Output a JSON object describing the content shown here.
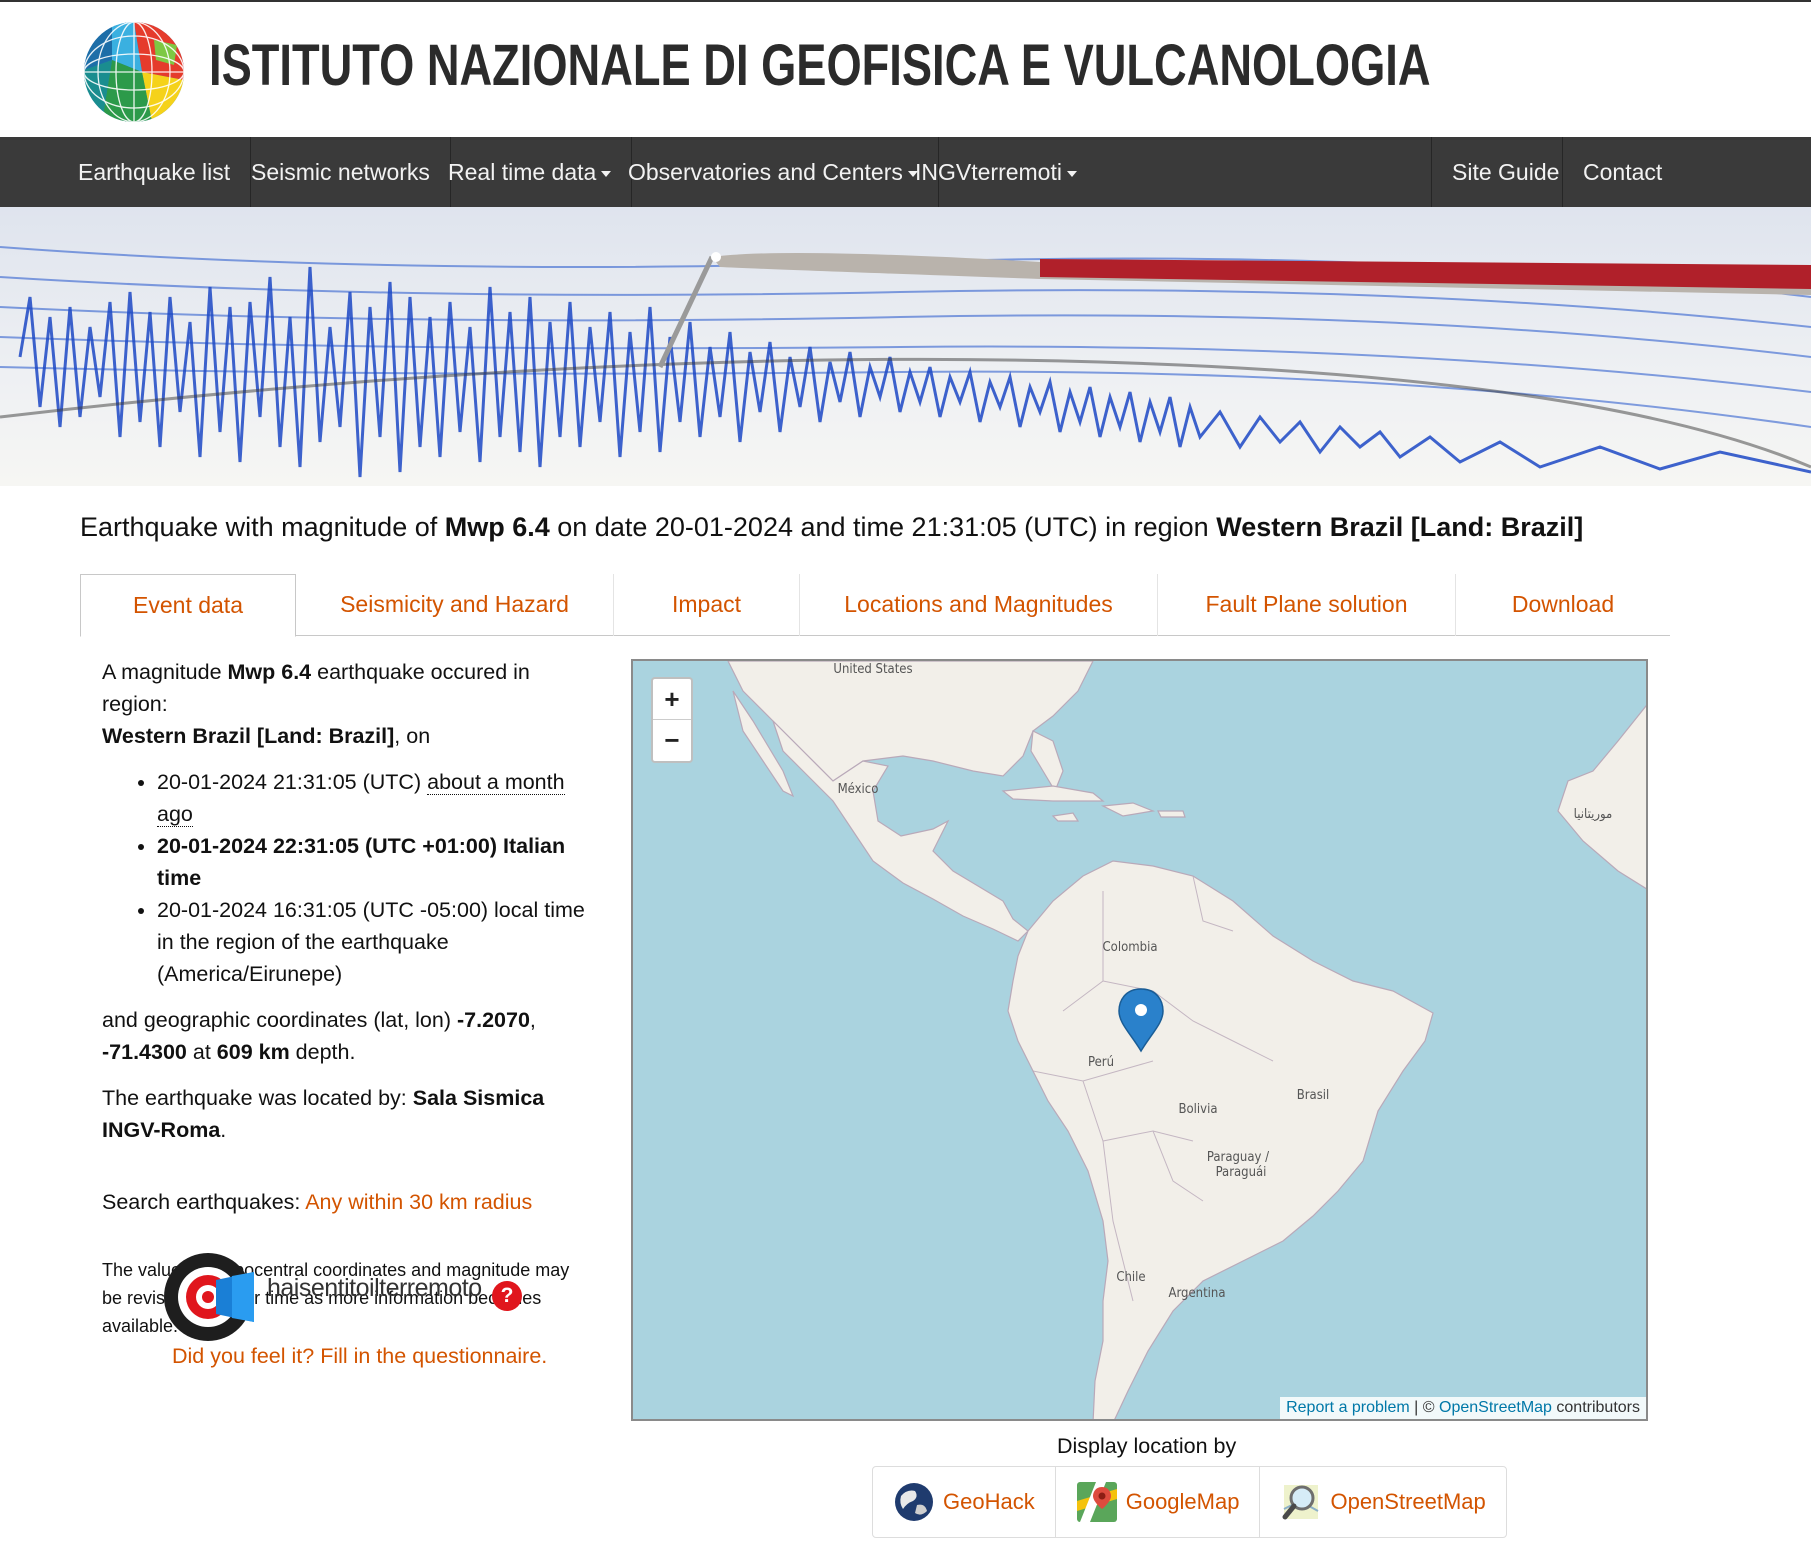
{
  "header": {
    "title": "ISTITUTO NAZIONALE DI GEOFISICA E VULCANOLOGIA"
  },
  "nav": {
    "items": [
      {
        "label": "Earthquake list",
        "dropdown": false
      },
      {
        "label": "Seismic networks",
        "dropdown": false
      },
      {
        "label": "Real time data",
        "dropdown": true
      },
      {
        "label": "Observatories and Centers",
        "dropdown": true
      },
      {
        "label": "INGVterremoti",
        "dropdown": true
      }
    ],
    "right_items": [
      {
        "label": "Site Guide"
      },
      {
        "label": "Contact"
      }
    ]
  },
  "headline": {
    "prefix": "Earthquake with magnitude of ",
    "magnitude": "Mwp 6.4",
    "mid1": " on date ",
    "date": "20-01-2024",
    "mid2": " and time ",
    "time": "21:31:05 (UTC)",
    "mid3": " in region ",
    "region": "Western Brazil [Land: Brazil]"
  },
  "tabs": [
    {
      "label": "Event data",
      "active": true
    },
    {
      "label": "Seismicity and Hazard",
      "active": false
    },
    {
      "label": "Impact",
      "active": false
    },
    {
      "label": "Locations and Magnitudes",
      "active": false
    },
    {
      "label": "Fault Plane solution",
      "active": false
    },
    {
      "label": "Download",
      "active": false
    }
  ],
  "event": {
    "intro_a": "A magnitude ",
    "magnitude": "Mwp 6.4",
    "intro_b": " earthquake occured in region:",
    "region": "Western Brazil [Land: Brazil]",
    "intro_c": ", on",
    "times": {
      "utc": "20-01-2024 21:31:05 (UTC)",
      "ago": "about a month ago",
      "italian": "20-01-2024 22:31:05 (UTC +01:00) Italian time",
      "local": "20-01-2024 16:31:05 (UTC -05:00) local time in the region of the earthquake (America/Eirunepe)"
    },
    "coords_a": "and geographic coordinates (lat, lon) ",
    "lat": "-7.2070",
    "comma": ",",
    "lon": "-71.4300",
    "at": " at ",
    "depth": "609 km",
    "depth_suffix": " depth.",
    "located_a": "The earthquake was located by: ",
    "located_by": "Sala Sismica INGV-Roma",
    "located_end": ".",
    "search_label": "Search earthquakes: ",
    "search_link": "Any within 30 km radius",
    "note": "The values of hypocentral coordinates and magnitude may be revised at a later time as more information becomes available.",
    "hsit_logo_text": "haisentitoilterremoto",
    "hsit_q": "?",
    "feel_link": "Did you feel it? Fill in the questionnaire."
  },
  "map": {
    "zoom_in": "+",
    "zoom_out": "−",
    "labels": {
      "us": "United States",
      "mexico": "México",
      "colombia": "Colombia",
      "peru": "Perú",
      "bolivia": "Bolivia",
      "brasil": "Brasil",
      "paraguay": "Paraguay /",
      "paraguai": "Paraguái",
      "chile": "Chile",
      "argentina": "Argentina",
      "mauritania": "موريتانيا"
    },
    "attribution": {
      "report": "Report a problem",
      "sep": " | © ",
      "osm": "OpenStreetMap",
      "contrib": " contributors"
    }
  },
  "display": {
    "title": "Display location by",
    "buttons": [
      {
        "label": "GeoHack",
        "icon": "globe-icon"
      },
      {
        "label": "GoogleMap",
        "icon": "googlemap-icon"
      },
      {
        "label": "OpenStreetMap",
        "icon": "magnifier-icon"
      }
    ]
  },
  "colors": {
    "link": "#d35400",
    "navbar": "#3a3a3a",
    "map_water": "#aad3df",
    "map_land": "#f2efe9",
    "marker": "#2a81cb"
  }
}
